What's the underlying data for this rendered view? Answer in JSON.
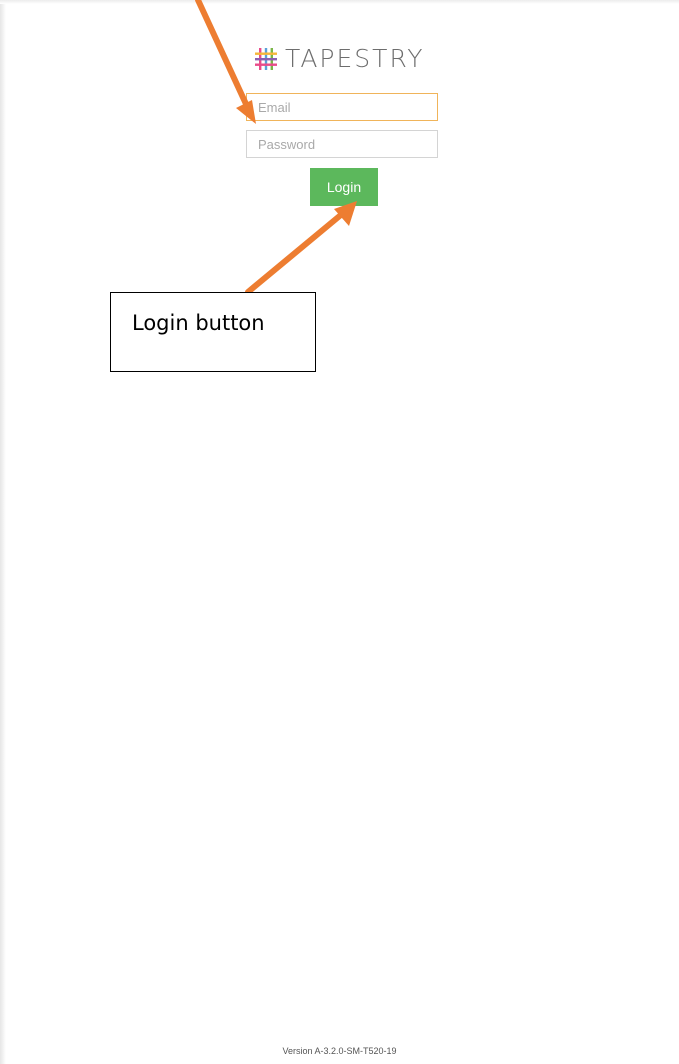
{
  "brand": {
    "logo_text": "TAPESTRY",
    "logo_icon": "tapestry-weave-icon",
    "logo_colors": [
      "#e94b8a",
      "#f6b63a",
      "#7ab648",
      "#5aa0d8",
      "#8a5fb0"
    ]
  },
  "login_form": {
    "email_placeholder": "Email",
    "email_value": "",
    "password_placeholder": "Password",
    "password_value": "",
    "login_label": "Login",
    "login_button_color": "#5cb85c",
    "focused_field_border": "#f0b45a"
  },
  "annotation": {
    "callout_text": "Login button",
    "arrow_color": "#ed7d31"
  },
  "footer": {
    "version": "Version A-3.2.0-SM-T520-19"
  }
}
